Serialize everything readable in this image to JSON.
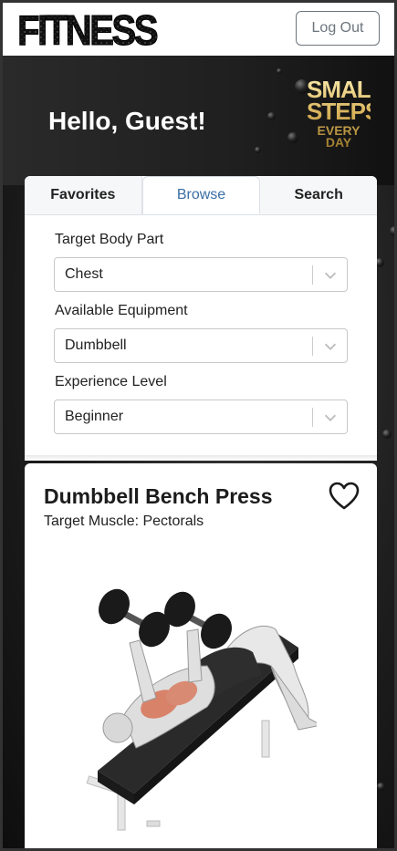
{
  "app": {
    "logo_text": "FITNESS",
    "logout_label": "Log Out"
  },
  "hero": {
    "greeting": "Hello, Guest!",
    "slogan_line1": "SMALL",
    "slogan_line2": "STEPS",
    "slogan_line3": "EVERY DAY"
  },
  "tabs": [
    {
      "label": "Favorites",
      "active": false
    },
    {
      "label": "Browse",
      "active": true
    },
    {
      "label": "Search",
      "active": false
    }
  ],
  "filters": {
    "body_part": {
      "label": "Target Body Part",
      "value": "Chest"
    },
    "equipment": {
      "label": "Available Equipment",
      "value": "Dumbbell"
    },
    "level": {
      "label": "Experience Level",
      "value": "Beginner"
    }
  },
  "exercise": {
    "name": "Dumbbell Bench Press",
    "target": "Target Muscle: Pectorals",
    "favorite_icon": "heart-outline-icon"
  },
  "colors": {
    "active_tab": "#3a6ea5",
    "muscle_highlight": "#d9826a",
    "gold": "#d8b25a"
  }
}
